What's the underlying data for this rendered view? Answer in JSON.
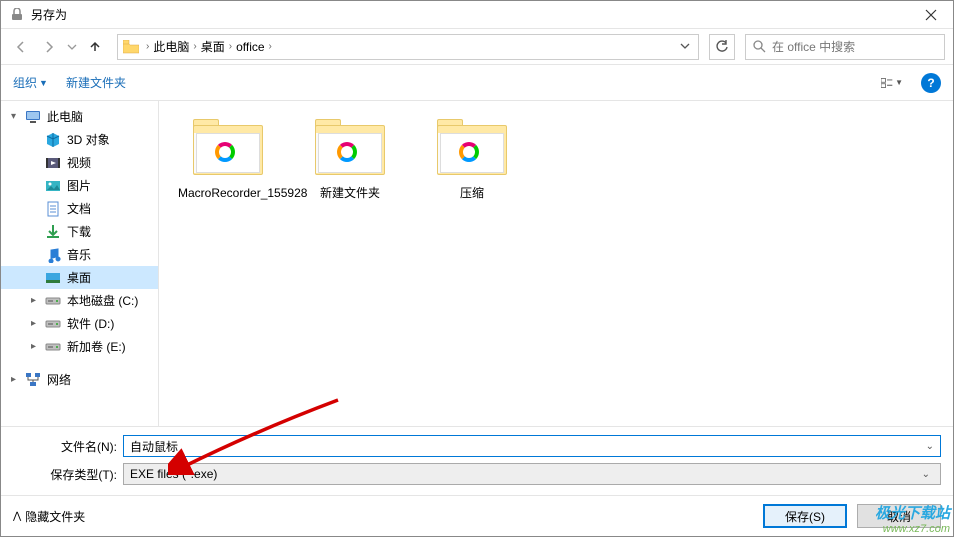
{
  "window": {
    "title": "另存为"
  },
  "nav": {
    "breadcrumbs": [
      "此电脑",
      "桌面",
      "office"
    ],
    "search_placeholder": "在 office 中搜索"
  },
  "toolbar": {
    "organize": "组织",
    "new_folder": "新建文件夹"
  },
  "sidebar": {
    "items": [
      {
        "label": "此电脑",
        "icon": "pc",
        "level": 1,
        "toggle": "▾"
      },
      {
        "label": "3D 对象",
        "icon": "3d",
        "level": 2
      },
      {
        "label": "视频",
        "icon": "video",
        "level": 2
      },
      {
        "label": "图片",
        "icon": "pictures",
        "level": 2
      },
      {
        "label": "文档",
        "icon": "docs",
        "level": 2
      },
      {
        "label": "下载",
        "icon": "downloads",
        "level": 2
      },
      {
        "label": "音乐",
        "icon": "music",
        "level": 2
      },
      {
        "label": "桌面",
        "icon": "desktop",
        "level": 2,
        "selected": true
      },
      {
        "label": "本地磁盘 (C:)",
        "icon": "drive",
        "level": 2,
        "toggle": "▸"
      },
      {
        "label": "软件 (D:)",
        "icon": "drive",
        "level": 2,
        "toggle": "▸"
      },
      {
        "label": "新加卷 (E:)",
        "icon": "drive",
        "level": 2,
        "toggle": "▸"
      },
      {
        "label": "网络",
        "icon": "network",
        "level": 1,
        "toggle": "▸",
        "gapBefore": true
      }
    ]
  },
  "files": [
    {
      "label": "MacroRecorder_155928"
    },
    {
      "label": "新建文件夹"
    },
    {
      "label": "压缩"
    }
  ],
  "fields": {
    "filename_label": "文件名(N):",
    "filename_value": "自动鼠标",
    "type_label": "保存类型(T):",
    "type_value": "EXE files (*.exe)"
  },
  "actions": {
    "hide_folders": "隐藏文件夹",
    "save": "保存(S)",
    "cancel": "取消"
  },
  "watermark": {
    "cn": "极光下载站",
    "url": "www.xz7.com"
  }
}
